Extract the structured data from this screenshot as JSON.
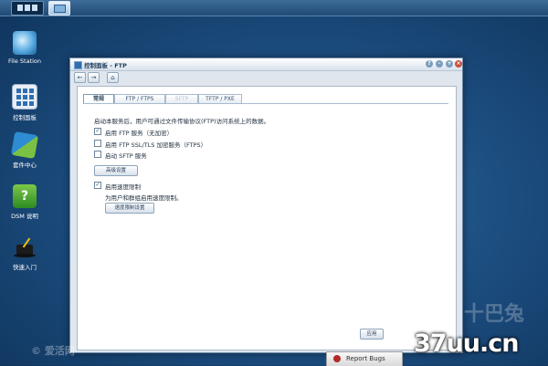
{
  "desktop": {
    "icons": [
      {
        "label": "File Station",
        "icon": "folder-magnifier-icon"
      },
      {
        "label": "控制面板",
        "icon": "control-panel-icon"
      },
      {
        "label": "套件中心",
        "icon": "package-center-icon"
      },
      {
        "label": "DSM 说明",
        "icon": "help-book-icon"
      },
      {
        "label": "快速入门",
        "icon": "magic-hat-icon"
      }
    ]
  },
  "window": {
    "title": "控制面板 - FTP",
    "controls": [
      "?",
      "–",
      "+",
      "×"
    ]
  },
  "toolbar": {
    "back": "←",
    "forward": "→",
    "home": "⌂"
  },
  "tabs": [
    {
      "label": "常规",
      "active": true
    },
    {
      "label": "FTP / FTPS",
      "active": false
    },
    {
      "label": "SFTP",
      "active": false,
      "disabled": true
    },
    {
      "label": "TFTP / PXE",
      "active": false
    }
  ],
  "general": {
    "intro": "启动本服务后，用户可通过文件传输协议(FTP)访问系统上的数据。",
    "options": [
      {
        "label": "启用 FTP 服务（无加密）",
        "checked": true
      },
      {
        "label": "启用 FTP SSL/TLS 加密服务（FTPS）",
        "checked": false
      },
      {
        "label": "启动 SFTP 服务",
        "checked": false
      }
    ],
    "advanced_button": "高级设置",
    "speed_limit": {
      "label": "启用速度限制",
      "checked": true
    },
    "speed_note": "为用户和群组启用速度限制。",
    "speed_button": "速度限制设置"
  },
  "footer": {
    "ok_button": "应用"
  },
  "report_bugs": "Report Bugs",
  "watermarks": {
    "left": "© 爱活网",
    "right_cn": "十巴兔",
    "site": "37uu.cn"
  },
  "colors": {
    "desktop": "#1d4f82",
    "accent": "#2f6fb0",
    "close": "#c94f3e"
  }
}
